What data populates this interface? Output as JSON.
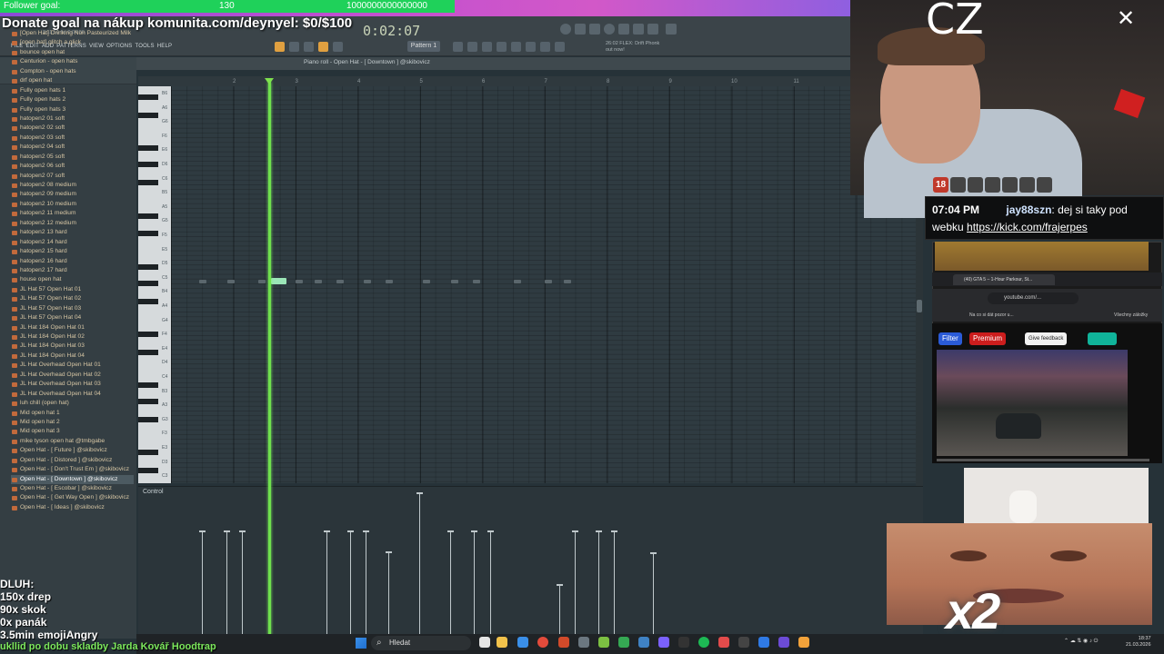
{
  "overlay": {
    "follower_goal_label": "Follower goal:",
    "follower_goal_current": "130",
    "follower_goal_target": "1000000000000000",
    "donate_text": "Donate goal na nákup komunita.com/deynyel: $0/$100"
  },
  "fl": {
    "time": "0:02:07",
    "pattern": "Pattern 1",
    "menu": [
      "FILE",
      "EDIT",
      "ADD",
      "PATTERNS",
      "VIEW",
      "OPTIONS",
      "TOOLS",
      "HELP"
    ],
    "info": "2:11:50 for 0:04:00",
    "flex_line1": "26:02  FLEX: Drift Phonk",
    "flex_line2": "out now!",
    "piano_roll_title": "Piano roll - Open Hat - [ Downtown ] @skibovicz",
    "control_label": "Control",
    "ruler_numbers": [
      "2",
      "3",
      "4",
      "5",
      "6",
      "7",
      "8",
      "9",
      "10",
      "11"
    ],
    "key_labels": [
      "B6",
      "A6",
      "G6",
      "F6",
      "E6",
      "D6",
      "C6",
      "B5",
      "A5",
      "G5",
      "F5",
      "E5",
      "D5",
      "C5",
      "B4",
      "A4",
      "G4",
      "F4",
      "E4",
      "D4",
      "C4",
      "B3",
      "A3",
      "G3",
      "F3",
      "E3",
      "D3",
      "C3"
    ]
  },
  "browser": {
    "items": [
      "[Open Hat] Drinking Non Pasteurized Milk",
      "[open hat] glitch a glick",
      "bounce open hat",
      "Centurion - open hats",
      "Compton - open hats",
      "drf open hat",
      "Fully open hats 1",
      "Fully open hats 2",
      "Fully open hats 3",
      "hatopen2 01 soft",
      "hatopen2 02 soft",
      "hatopen2 03 soft",
      "hatopen2 04 soft",
      "hatopen2 05 soft",
      "hatopen2 06 soft",
      "hatopen2 07 soft",
      "hatopen2 08 medium",
      "hatopen2 09 medium",
      "hatopen2 10 medium",
      "hatopen2 11 medium",
      "hatopen2 12 medium",
      "hatopen2 13 hard",
      "hatopen2 14 hard",
      "hatopen2 15 hard",
      "hatopen2 16 hard",
      "hatopen2 17 hard",
      "house open hat",
      "JL Hat 57 Open Hat 01",
      "JL Hat 57 Open Hat 02",
      "JL Hat 57 Open Hat 03",
      "JL Hat 57 Open Hat 04",
      "JL Hat 184 Open Hat 01",
      "JL Hat 184 Open Hat 02",
      "JL Hat 184 Open Hat 03",
      "JL Hat 184 Open Hat 04",
      "JL Hat Overhead Open Hat 01",
      "JL Hat Overhead Open Hat 02",
      "JL Hat Overhead Open Hat 03",
      "JL Hat Overhead Open Hat 04",
      "luh chill (open hat)",
      "Mid open hat 1",
      "Mid open hat 2",
      "Mid open hat 3",
      "mike tyson open hat @tmbgabe",
      "Open Hat - [ Future ] @skibovicz",
      "Open Hat - [ Distored ] @skibovicz",
      "Open Hat - [ Don't Trust Em ] @skibovicz",
      "Open Hat - [ Downtown ] @skibovicz",
      "Open Hat - [ Escobar ] @skibovicz",
      "Open Hat - [ Get Way Open ] @skibovicz",
      "Open Hat - [ Ideas ] @skibovicz"
    ],
    "selected_index": 47
  },
  "webcam": {
    "brand": "CZ",
    "badge_age": "18"
  },
  "chat": {
    "time": "07:04 PM",
    "user": "jay88szn",
    "message": ": dej si taky pod webku ",
    "link": "https://kick.com/frajerpes"
  },
  "youtube": {
    "tab_title": "(40) GTA 5 – 1-Hour Parkour, St...",
    "url": "youtube.com/...",
    "bookmark": "Na co si dát pozor u...",
    "all_bookmarks": "Všechny záložky",
    "chip_filter": "Filter",
    "chip_premium": "Premium",
    "chip_feedback": "Give feedback"
  },
  "reaction": {
    "multiplier": "x2"
  },
  "dluh": {
    "title": "DLUH:",
    "lines": [
      "150x drep",
      "90x skok",
      "0x panák",
      "3.5min emojiAngry"
    ],
    "song": "ukllid po dobu skladby Jarda Kovář Hoodtrap"
  },
  "taskbar": {
    "search": "Hledat",
    "clock_time": "18:37",
    "clock_date": "21.03.2026"
  },
  "colors": {
    "playhead": "#6fe14d",
    "note": "#9be6b7",
    "follower_bar": "#1fd15a",
    "donate_gradient_start": "#8a4ad6",
    "dluh_green": "#7ce85c"
  },
  "notes": {
    "active_step_beats": [
      2.1
    ],
    "ghost_step_beats": [
      1.45,
      1.9,
      2.4,
      3.0,
      3.3,
      3.65,
      4.1,
      4.45,
      5.05,
      5.5,
      5.85,
      6.5,
      7.0,
      7.3
    ]
  },
  "velocities": [
    0.7,
    0.7,
    0.7,
    0.0,
    0.7,
    0.7,
    0.7,
    0.56,
    0.95,
    0.7,
    0.7,
    0.7,
    0.34,
    0.7,
    0.7,
    0.7,
    0.55
  ]
}
